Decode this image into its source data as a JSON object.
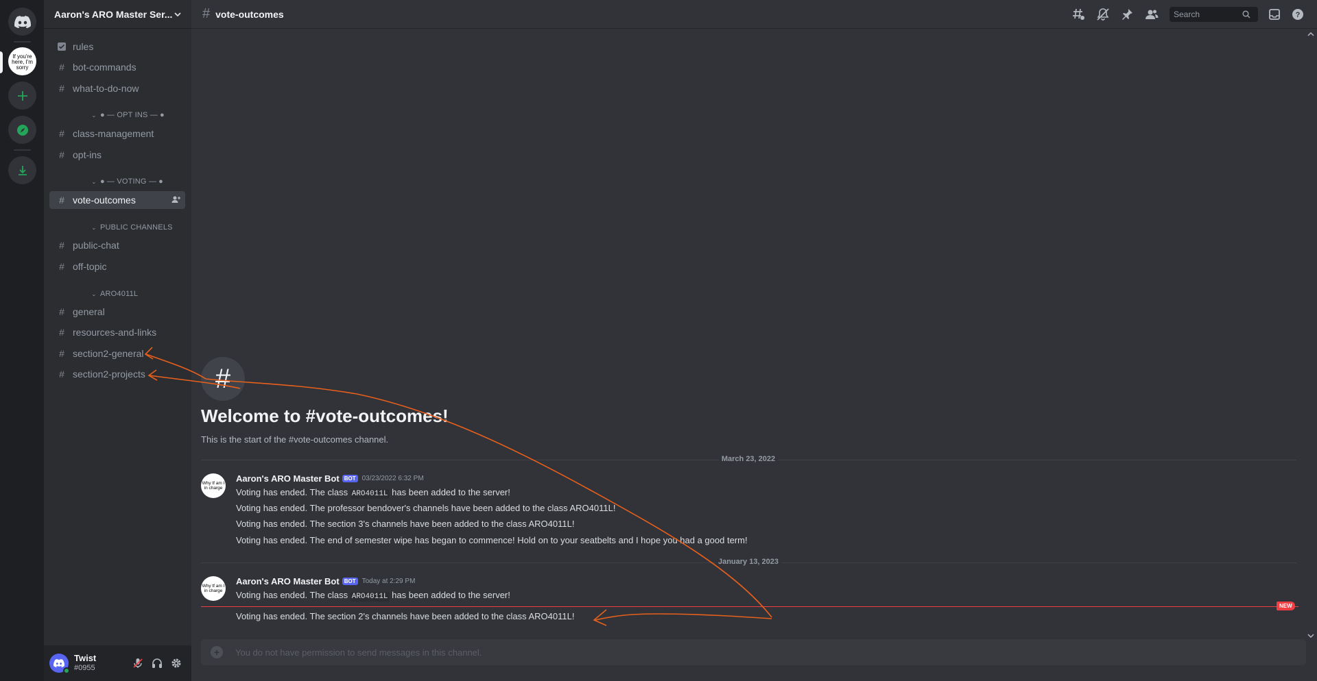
{
  "rail": {
    "server_avatar_text": "If you're here, I'm sorry"
  },
  "server": {
    "name": "Aaron's ARO Master Ser..."
  },
  "channels": {
    "rules": "rules",
    "bot_commands": "bot-commands",
    "what_to_do_now": "what-to-do-now",
    "cat_opt_ins": "— OPT INS —",
    "class_management": "class-management",
    "opt_ins": "opt-ins",
    "cat_voting": "— VOTING —",
    "vote_outcomes": "vote-outcomes",
    "cat_public": "PUBLIC CHANNELS",
    "public_chat": "public-chat",
    "off_topic": "off-topic",
    "cat_aro": "ARO4011L",
    "general": "general",
    "resources_and_links": "resources-and-links",
    "section2_general": "section2-general",
    "section2_projects": "section2-projects"
  },
  "user": {
    "name": "Twist",
    "discriminator": "#0955"
  },
  "header": {
    "channel": "vote-outcomes",
    "search_placeholder": "Search"
  },
  "welcome": {
    "hash": "#",
    "title": "Welcome to #vote-outcomes!",
    "subtitle": "This is the start of the #vote-outcomes channel."
  },
  "dividers": {
    "first": "March 23, 2022",
    "second": "January 13, 2023",
    "new_badge": "NEW"
  },
  "messages": {
    "avatar_text": "Why tf am I in charge",
    "group1": {
      "author": "Aaron's ARO Master Bot",
      "tag": "BOT",
      "time": "03/23/2022 6:32 PM",
      "line1_pre": "Voting has ended. The class ",
      "line1_code": "ARO4011L",
      "line1_post": " has been added to the server!",
      "line2": "Voting has ended. The professor bendover's channels have been added to the class ARO4011L!",
      "line3": "Voting has ended. The section 3's channels have been added to the class ARO4011L!",
      "line4": "Voting has ended. The end of semester wipe has began to commence! Hold on to your seatbelts and I hope you had a good term!"
    },
    "group2": {
      "author": "Aaron's ARO Master Bot",
      "tag": "BOT",
      "time": "Today at 2:29 PM",
      "line1_pre": "Voting has ended. The class ",
      "line1_code": "ARO4011L",
      "line1_post": " has been added to the server!",
      "line2": "Voting has ended. The section 2's channels have been added to the class ARO4011L!"
    }
  },
  "composer": {
    "placeholder": "You do not have permission to send messages in this channel."
  },
  "colors": {
    "annotation": "#e8601c",
    "accent": "#5865f2",
    "online": "#23a55a",
    "new": "#f23f43"
  }
}
